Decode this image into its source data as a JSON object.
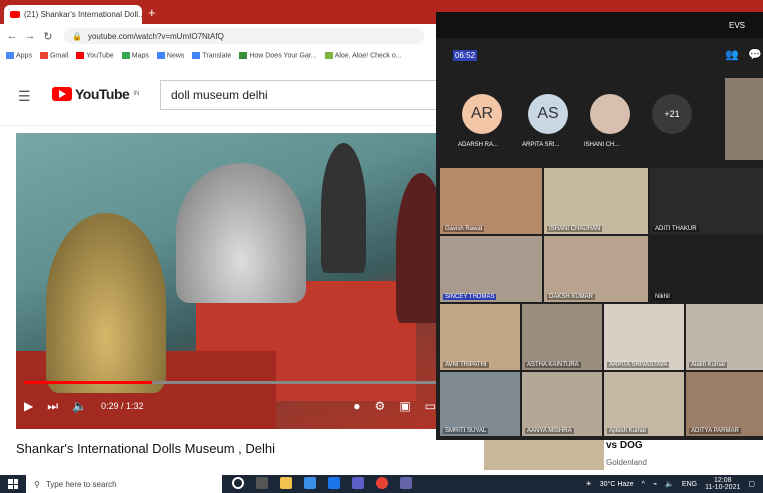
{
  "browser": {
    "tab_title": "(21) Shankar's International Doll...",
    "tab_close": "✕",
    "new_tab": "+",
    "url": "youtube.com/watch?v=mUmIO7NtAfQ",
    "bookmarks": [
      "Apps",
      "Gmail",
      "YouTube",
      "Maps",
      "News",
      "Translate",
      "How Does Your Gar...",
      "Aloe, Aloe! Check o..."
    ]
  },
  "youtube": {
    "logo_text": "YouTube",
    "region": "IN",
    "search_query": "doll museum delhi",
    "time": "0:29 / 1:32",
    "progress": 0.31,
    "title": "Shankar's International Dolls Museum , Delhi",
    "side_title": "vs DOG",
    "side_channel": "Goldenland"
  },
  "teams": {
    "header": "EVS",
    "timer": "06:52",
    "avatars": [
      {
        "initials": "AR",
        "name": "ADARSH RA...",
        "color": "#f4c6a8"
      },
      {
        "initials": "AS",
        "name": "ARPITA SRI...",
        "color": "#c9d6e3"
      },
      {
        "initials": "",
        "name": "ISHANI CH...",
        "color": "#d8c0b0"
      },
      {
        "initials": "+21",
        "name": "",
        "color": "#3a3a3a"
      }
    ],
    "tiles": [
      {
        "name": "Gavish Rawat",
        "color": "#b58a6a"
      },
      {
        "name": "ISHANI CHAUHAN",
        "color": "#c7b9a0"
      },
      {
        "name": "ADITI THAKUR",
        "color": "#2a2a2a"
      },
      {
        "name": "SINCEY THOMAS",
        "color": "#a89a8c"
      },
      {
        "name": "DAKSH KUMAR",
        "color": "#b8a48e"
      },
      {
        "name": "Nikhil",
        "color": "#1e1e1e"
      },
      {
        "name": "AVNI TRIPATHI",
        "color": "#c2a585"
      },
      {
        "name": "ASTHA KAINTURA",
        "color": "#9a8d7e"
      },
      {
        "name": "ARPITA SRIVASTAVA",
        "color": "#d9cfc2"
      },
      {
        "name": "Alakh Kumar",
        "color": "#bfb5ab"
      },
      {
        "name": "SMRITI SUYAL",
        "color": "#7f8a93"
      },
      {
        "name": "AANYA MISHRA",
        "color": "#b5a796"
      },
      {
        "name": "Ajitesh Kumar",
        "color": "#c5b8a5"
      },
      {
        "name": "ADITYA PARMAR",
        "color": "#9c7e68"
      }
    ]
  },
  "taskbar": {
    "search_placeholder": "Type here to search",
    "weather": "30°C Haze",
    "lang": "ENG",
    "time": "12:08",
    "date": "11-10-2021"
  }
}
